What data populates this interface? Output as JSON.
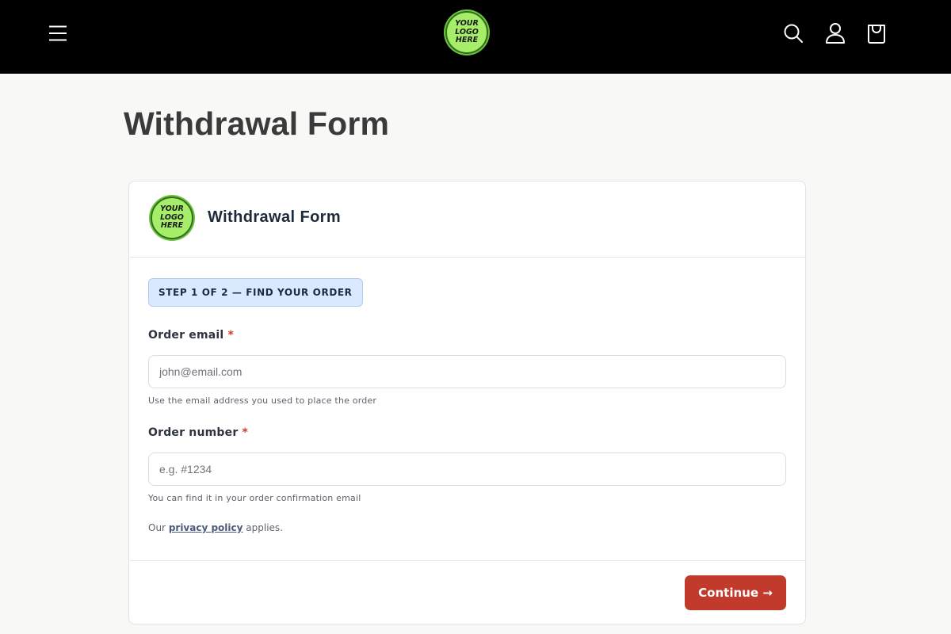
{
  "header": {
    "logo_lines": [
      "YOUR",
      "LOGO",
      "HERE"
    ]
  },
  "page": {
    "title": "Withdrawal Form"
  },
  "card": {
    "logo_lines": [
      "YOUR",
      "LOGO",
      "HERE"
    ],
    "title": "Withdrawal Form",
    "step_label": "STEP 1 OF 2 — FIND YOUR ORDER",
    "fields": [
      {
        "label": "Order email",
        "required_mark": "*",
        "value": "",
        "placeholder": "john@email.com",
        "hint": "Use the email address you used to place the order"
      },
      {
        "label": "Order number",
        "required_mark": "*",
        "value": "",
        "placeholder": "e.g. #1234",
        "hint": "You can find it in your order confirmation email"
      }
    ],
    "privacy": {
      "prefix": "Our",
      "link": "privacy policy",
      "suffix": "applies."
    },
    "continue_label": "Continue →"
  },
  "colors": {
    "header_bg": "#000000",
    "page_bg": "#f8f8f6",
    "accent_button": "#c13a2c",
    "step_pill_bg": "#dbe9ff",
    "required": "#d33a2c",
    "logo_green": "#a6ee6a"
  },
  "icons": {
    "menu": "hamburger-menu-icon",
    "search": "search-icon",
    "account": "user-icon",
    "cart": "shopping-bag-icon"
  }
}
